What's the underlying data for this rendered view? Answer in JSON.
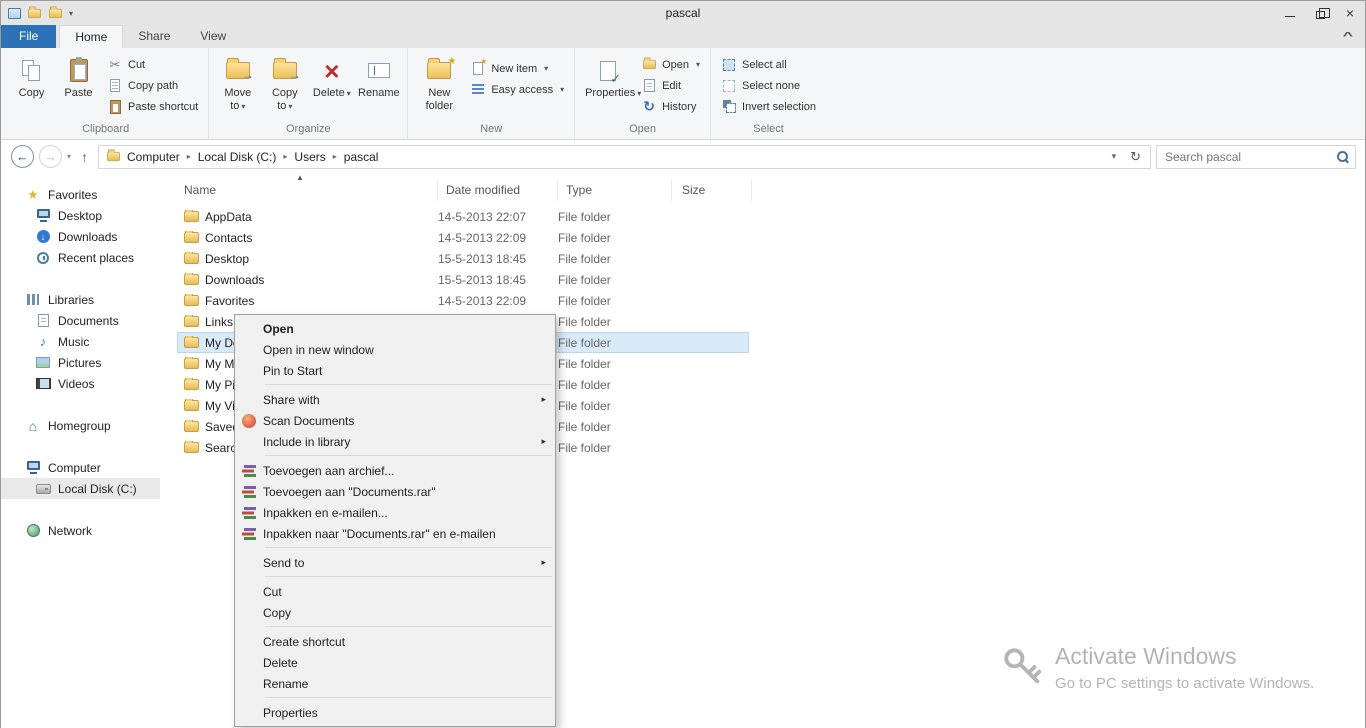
{
  "window": {
    "title": "pascal"
  },
  "icons": {
    "chevron_down": "▾",
    "chevron_right": "▸",
    "chevron_up": "^",
    "sort_asc": "▲",
    "back": "←",
    "forward": "→",
    "up": "↑",
    "down": "↓",
    "refresh": "↻",
    "close": "×",
    "delete_x": "×",
    "star": "★",
    "music": "♪",
    "cut": "✂",
    "house": "⌂",
    "history": "↻"
  },
  "ribbon": {
    "file_tab": "File",
    "tabs": [
      "Home",
      "Share",
      "View"
    ],
    "clipboard": {
      "label": "Clipboard",
      "copy": "Copy",
      "paste": "Paste",
      "cut": "Cut",
      "copy_path": "Copy path",
      "paste_shortcut": "Paste shortcut"
    },
    "organize": {
      "label": "Organize",
      "move_to": "Move to",
      "copy_to": "Copy to",
      "delete": "Delete",
      "rename": "Rename"
    },
    "new": {
      "label": "New",
      "new_folder": "New folder",
      "new_item": "New item",
      "easy_access": "Easy access"
    },
    "open": {
      "label": "Open",
      "properties": "Properties",
      "open": "Open",
      "edit": "Edit",
      "history": "History"
    },
    "select": {
      "label": "Select",
      "select_all": "Select all",
      "select_none": "Select none",
      "invert": "Invert selection"
    }
  },
  "addressbar": {
    "breadcrumb": [
      "Computer",
      "Local Disk (C:)",
      "Users",
      "pascal"
    ],
    "search_placeholder": "Search pascal"
  },
  "sidebar": {
    "items": [
      {
        "label": "Favorites"
      },
      {
        "label": "Desktop"
      },
      {
        "label": "Downloads"
      },
      {
        "label": "Recent places"
      },
      {
        "label": "Libraries"
      },
      {
        "label": "Documents"
      },
      {
        "label": "Music"
      },
      {
        "label": "Pictures"
      },
      {
        "label": "Videos"
      },
      {
        "label": "Homegroup"
      },
      {
        "label": "Computer"
      },
      {
        "label": "Local Disk (C:)"
      },
      {
        "label": "Network"
      }
    ]
  },
  "files": {
    "columns": [
      "Name",
      "Date modified",
      "Type",
      "Size"
    ],
    "rows": [
      {
        "name": "AppData",
        "date": "14-5-2013 22:07",
        "type": "File folder",
        "size": ""
      },
      {
        "name": "Contacts",
        "date": "14-5-2013 22:09",
        "type": "File folder",
        "size": ""
      },
      {
        "name": "Desktop",
        "date": "15-5-2013 18:45",
        "type": "File folder",
        "size": ""
      },
      {
        "name": "Downloads",
        "date": "15-5-2013 18:45",
        "type": "File folder",
        "size": ""
      },
      {
        "name": "Favorites",
        "date": "14-5-2013 22:09",
        "type": "File folder",
        "size": ""
      },
      {
        "name": "Links",
        "date": "",
        "type": "File folder",
        "size": ""
      },
      {
        "name": "My Do",
        "date": "",
        "type": "File folder",
        "size": ""
      },
      {
        "name": "My Mu",
        "date": "",
        "type": "File folder",
        "size": ""
      },
      {
        "name": "My Pic",
        "date": "",
        "type": "File folder",
        "size": ""
      },
      {
        "name": "My Vid",
        "date": "",
        "type": "File folder",
        "size": ""
      },
      {
        "name": "Saved",
        "date": "",
        "type": "File folder",
        "size": ""
      },
      {
        "name": "Search",
        "date": "",
        "type": "File folder",
        "size": ""
      }
    ]
  },
  "context_menu": {
    "items": [
      {
        "label": "Open"
      },
      {
        "label": "Open in new window"
      },
      {
        "label": "Pin to Start"
      },
      {
        "label": "Share with"
      },
      {
        "label": "Scan Documents"
      },
      {
        "label": "Include in library"
      },
      {
        "label": "Toevoegen aan archief..."
      },
      {
        "label": "Toevoegen aan \"Documents.rar\""
      },
      {
        "label": "Inpakken en e-mailen..."
      },
      {
        "label": "Inpakken naar \"Documents.rar\" en e-mailen"
      },
      {
        "label": "Send to"
      },
      {
        "label": "Cut"
      },
      {
        "label": "Copy"
      },
      {
        "label": "Create shortcut"
      },
      {
        "label": "Delete"
      },
      {
        "label": "Rename"
      },
      {
        "label": "Properties"
      }
    ]
  },
  "watermark": {
    "title": "Activate Windows",
    "subtitle": "Go to PC settings to activate Windows."
  }
}
